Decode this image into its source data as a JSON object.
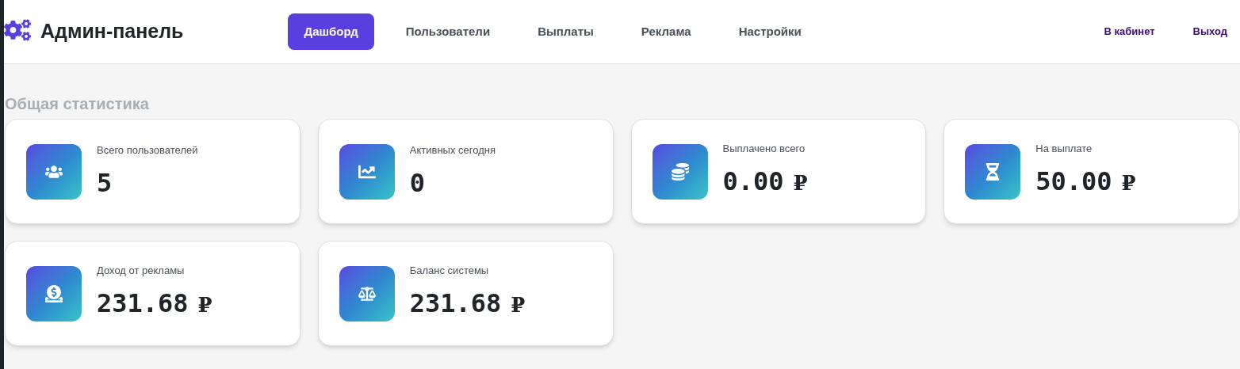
{
  "header": {
    "title": "Админ-панель",
    "nav": [
      {
        "label": "Дашборд",
        "selected": true
      },
      {
        "label": "Пользователи",
        "selected": false
      },
      {
        "label": "Выплаты",
        "selected": false
      },
      {
        "label": "Реклама",
        "selected": false
      },
      {
        "label": "Настройки",
        "selected": false
      }
    ],
    "links": [
      "В кабинет",
      "Выход"
    ]
  },
  "section_title": "Общая статистика",
  "stats": [
    {
      "label": "Всего пользователей",
      "value": "5"
    },
    {
      "label": "Активных сегодня",
      "value": "0"
    },
    {
      "label": "Выплачено всего",
      "value": "0.00",
      "currency": "₽"
    },
    {
      "label": "На выплате",
      "value": "50.00",
      "currency": "₽"
    },
    {
      "label": "Доход от рекламы",
      "value": "231.68",
      "currency": "₽"
    },
    {
      "label": "Баланс системы",
      "value": "231.68",
      "currency": "₽"
    }
  ]
}
